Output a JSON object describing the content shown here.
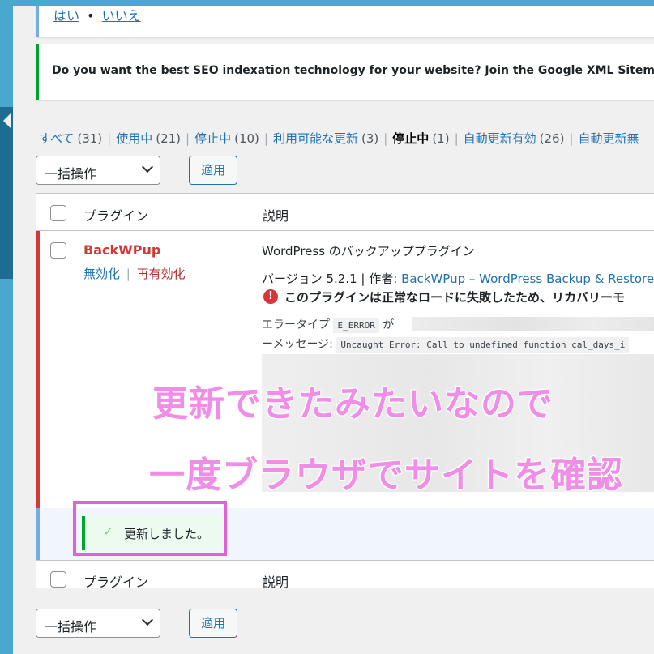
{
  "notice_top": {
    "yes": "はい",
    "bullet": "•",
    "no": "いいえ"
  },
  "notice_seo": {
    "text": "Do you want the best SEO indexation technology for your website? Join the Google XML Sitemaps Be"
  },
  "filters": [
    {
      "label": "すべて",
      "count": "(31)",
      "current": false
    },
    {
      "label": "使用中",
      "count": "(21)",
      "current": false
    },
    {
      "label": "停止中",
      "count": "(10)",
      "current": false
    },
    {
      "label": "利用可能な更新",
      "count": "(3)",
      "current": false
    },
    {
      "label": "停止中",
      "count": "(1)",
      "current": true
    },
    {
      "label": "自動更新有効",
      "count": "(26)",
      "current": false
    },
    {
      "label": "自動更新無",
      "count": "",
      "current": false
    }
  ],
  "filter_separator": "|",
  "bulk_actions": {
    "select_value": "一括操作",
    "apply_label": "適用"
  },
  "table": {
    "col_plugin": "プラグイン",
    "col_description": "説明",
    "plugin": {
      "name": "BackWPup",
      "deactivate": "無効化",
      "action_separator": "|",
      "reactivate": "再有効化",
      "description": "WordPress のバックアッププラグイン",
      "version_prefix": "バージョン 5.2.1 | 作者: ",
      "author_link": "BackWPup – WordPress Backup & Restore P",
      "error_message": "このプラグインは正常なロードに失敗したため、リカバリーモ",
      "error_type_label": "エラータイプ",
      "error_type_value": "E_ERROR",
      "error_type_suffix": "が",
      "error_msg_label": "ーメッセージ:",
      "error_msg_value": "Uncaught Error: Call to undefined function cal_days_i"
    },
    "updated_notice": "更新しました。"
  },
  "overlay": {
    "line1": "更新できたみたいなので",
    "line2": "一度ブラウザでサイトを確認"
  },
  "colors": {
    "accent": "#2271b1",
    "error": "#d63638",
    "success": "#00a32a",
    "overlay_pink": "#f08de6",
    "highlight": "#e063d6"
  }
}
